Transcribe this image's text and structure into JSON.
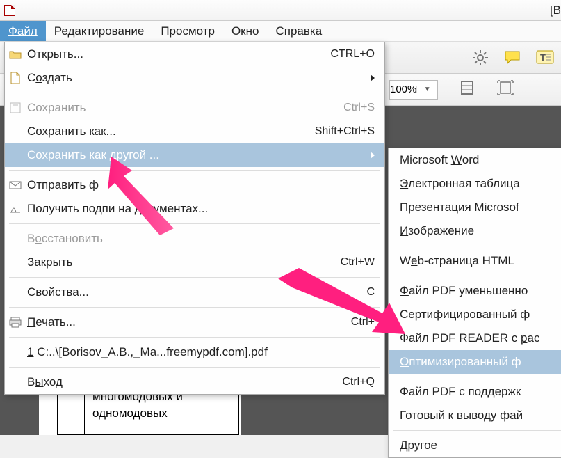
{
  "title_suffix": "[В",
  "menus": {
    "file": "Файл",
    "edit": "Редактирование",
    "view": "Просмотр",
    "window": "Окно",
    "help": "Справка"
  },
  "toolbar2": {
    "zoom": "100%"
  },
  "file_menu": {
    "open": {
      "label": "Открыть...",
      "key": "CTRL+O"
    },
    "create": {
      "label_prefix": "С",
      "label_u": "о",
      "label_suffix": "здать"
    },
    "save": {
      "label": "Сохранить",
      "key": "Ctrl+S"
    },
    "save_as": {
      "label_prefix": "Сохранить ",
      "label_u": "к",
      "label_suffix": "ак...",
      "key": "Shift+Ctrl+S"
    },
    "save_as_other": {
      "label": "Сохранить как другой ..."
    },
    "send": {
      "label": "Отправить ф"
    },
    "get_sig": {
      "label": "Получить подпи",
      "label_suffix": " на документах..."
    },
    "restore": {
      "label_prefix": "В",
      "label_u": "о",
      "label_suffix": "сстановить"
    },
    "close": {
      "label": "Закрыть",
      "key": "Ctrl+W"
    },
    "properties": {
      "label_prefix": "Сво",
      "label_u": "й",
      "label_suffix": "ства...",
      "key": "C"
    },
    "print": {
      "label_prefix": "",
      "label_u": "П",
      "label_suffix": "ечать...",
      "key": "Ctrl+"
    },
    "recent": {
      "label_prefix": "",
      "label_u": "1",
      "label_suffix": " C:..\\[Borisov_A.B.,_Ma...freemypdf.com].pdf"
    },
    "exit": {
      "label_prefix": "В",
      "label_u": "ы",
      "label_suffix": "ход",
      "key": "Ctrl+Q"
    }
  },
  "save_other_submenu": {
    "word": {
      "prefix": "Microsoft ",
      "u": "W",
      "suffix": "ord"
    },
    "excel": {
      "prefix": "",
      "u": "Э",
      "suffix": "лектронная таблица"
    },
    "ppt": {
      "prefix": "Презентация Microsof"
    },
    "image": {
      "prefix": "",
      "u": "И",
      "suffix": "зображение"
    },
    "web": {
      "prefix": "W",
      "u": "e",
      "suffix": "b-страница HTML"
    },
    "small_pdf": {
      "prefix": "",
      "u": "Ф",
      "suffix": "айл PDF уменьшенно"
    },
    "cert": {
      "prefix": "",
      "u": "С",
      "suffix": "ертифицированный ф"
    },
    "reader": {
      "prefix": "Файл PDF READER с ",
      "u": "р",
      "suffix": "ас"
    },
    "optimized": {
      "prefix": "",
      "u": "О",
      "suffix": "птимизированный ф"
    },
    "archive": {
      "prefix": "Файл PDF с поддержк"
    },
    "output": {
      "prefix": "Готовый к выводу фай"
    },
    "other": {
      "prefix": "",
      "u": "Д",
      "suffix": "ругое"
    }
  },
  "page_text": {
    "line1": "многомодовых и",
    "line2": "одномодовых"
  }
}
